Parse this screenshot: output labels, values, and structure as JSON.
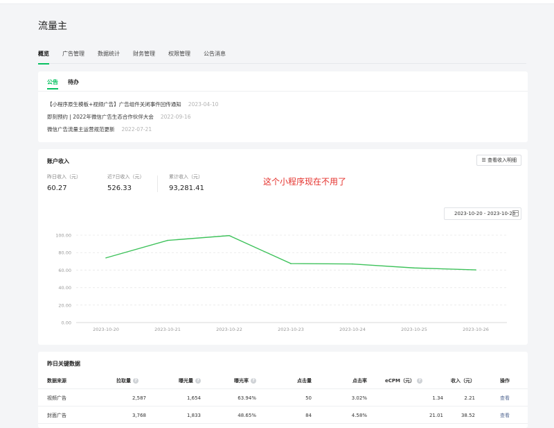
{
  "app_title": "流量主",
  "tabs": [
    "概览",
    "广告管理",
    "数据统计",
    "财务管理",
    "权限管理",
    "公告消息"
  ],
  "announcements": {
    "subtabs": [
      "公告",
      "待办"
    ],
    "items": [
      {
        "text": "【小程序原生模板+视频广告】广告组件关闭事件回传通知",
        "date": "2023-04-10"
      },
      {
        "text": "即刻预约 | 2022年微信广告生态合作伙伴大会",
        "date": "2022-09-16"
      },
      {
        "text": "微信广告流量主运营规范更新",
        "date": "2022-07-21"
      }
    ]
  },
  "income": {
    "title": "账户收入",
    "detail_button": "查看收入明细",
    "stats": [
      {
        "label": "昨日收入（元）",
        "value": "60.27"
      },
      {
        "label": "近7日收入（元）",
        "value": "526.33"
      },
      {
        "label": "累计收入（元）",
        "value": "93,281.41"
      }
    ],
    "annotation": "这个小程序现在不用了",
    "date_range": "2023-10-20 - 2023-10-26"
  },
  "chart_data": {
    "type": "line",
    "x": [
      "2023-10-20",
      "2023-10-21",
      "2023-10-22",
      "2023-10-23",
      "2023-10-24",
      "2023-10-25",
      "2023-10-26"
    ],
    "series": [
      {
        "values": [
          74,
          94,
          99.5,
          67.5,
          67,
          62.5,
          60.27
        ],
        "color": "#3ec25b"
      }
    ],
    "yticks": [
      "0.00",
      "20.00",
      "40.00",
      "60.00",
      "80.00",
      "100.00"
    ],
    "ylim": [
      0,
      100
    ],
    "grid": true,
    "grid_style": "dashed"
  },
  "key_data": {
    "title": "昨日关键数据",
    "columns": [
      "数据来源",
      "拉取量",
      "曝光量",
      "曝光率",
      "点击量",
      "点击率",
      "eCPM（元）",
      "收入（元）",
      "操作"
    ],
    "rows": [
      [
        "视频广告",
        "2,587",
        "1,654",
        "63.94%",
        "50",
        "3.02%",
        "1.34",
        "2.21",
        "查看"
      ],
      [
        "封面广告",
        "3,768",
        "1,833",
        "48.65%",
        "84",
        "4.58%",
        "21.01",
        "38.52",
        "查看"
      ]
    ]
  },
  "colors": {
    "accent": "#07c160",
    "line": "#3ec25b",
    "annotation": "#e5322d",
    "link": "#576b95"
  }
}
